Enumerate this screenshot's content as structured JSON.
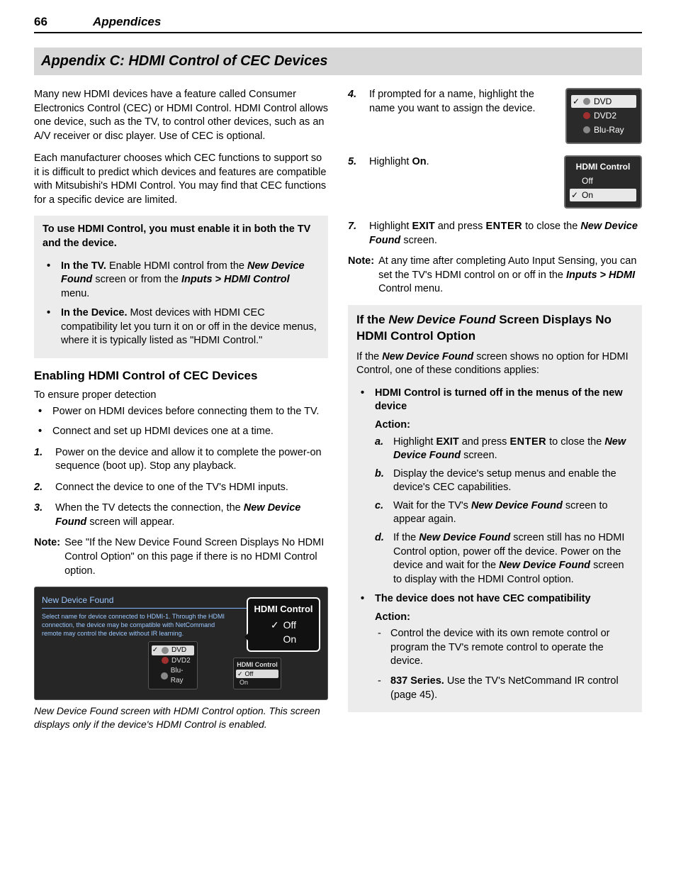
{
  "header": {
    "page": "66",
    "section": "Appendices"
  },
  "appendix_title": "Appendix C:  HDMI Control of CEC Devices",
  "left": {
    "intro1": "Many new HDMI devices have a feature called Consumer Electronics Control (CEC) or HDMI Control. HDMI Control allows one device, such as the TV, to control other devices, such as an A/V receiver or disc player.  Use of CEC is optional.",
    "intro2": "Each manufacturer chooses which CEC functions to support so it is difficult to predict which devices and features are compatible with Mitsubishi's HDMI Control. You may find that CEC functions for a specific device are limited.",
    "box": {
      "lead": "To use HDMI Control, you must enable it in both the TV and the device.",
      "tv_label": "In the TV.",
      "tv_text_a": "  Enable HDMI control from the ",
      "tv_text_b": "New Device Found",
      "tv_text_c": " screen or from the ",
      "tv_text_d": "Inputs > HDMI Control",
      "tv_text_e": " menu.",
      "dev_label": "In the Device.",
      "dev_text": "  Most devices with HDMI CEC compatibility let you turn it on or off in the device menus, where it is typically listed as \"HDMI Control.\""
    },
    "enable_head": "Enabling HDMI Control of CEC Devices",
    "ensure": "To ensure proper detection",
    "ensure_b1": "Power on HDMI devices before connecting them to the TV.",
    "ensure_b2": "Connect and set up HDMI devices one at a time.",
    "s1": {
      "n": "1.",
      "t": "Power on the device and allow it to complete the power-on sequence (boot up).  Stop any playback."
    },
    "s2": {
      "n": "2.",
      "t": "Connect the device to one of the TV's HDMI inputs."
    },
    "s3": {
      "n": "3.",
      "a": "When the TV detects the connection, the ",
      "b": "New Device Found",
      "c": " screen will appear."
    },
    "note": {
      "label": "Note:",
      "t": "See \"If the New Device Found Screen Displays No HDMI Control Option\" on this page if there is no HDMI Control option."
    },
    "shot": {
      "title": "New Device Found",
      "desc": "Select name for device connected to HDMI-1.\nThrough the HDMI connection, the device may be compatible with NetCommand remote may control the device without IR learning.",
      "dev": [
        "DVD",
        "DVD2",
        "Blu-Ray"
      ],
      "hdmi_label": "HDMI Control",
      "off": "Off",
      "on": "On"
    },
    "caption": "New Device Found screen with HDMI Control option. This screen displays only if the device's HDMI Control is enabled."
  },
  "right": {
    "s4": {
      "n": "4.",
      "t": "If prompted for a name, highlight the name you want to assign the device."
    },
    "box4": {
      "items": [
        "DVD",
        "DVD2",
        "Blu-Ray"
      ]
    },
    "s5": {
      "n": "5.",
      "a": "Highlight ",
      "b": "On",
      "c": "."
    },
    "box5": {
      "title": "HDMI Control",
      "off": "Off",
      "on": "On"
    },
    "s7": {
      "n": "7.",
      "a": "Highlight ",
      "b": "EXIT",
      "c": " and press ",
      "d": "ENTER",
      "e": " to close the ",
      "f": "New Device Found",
      "g": " screen."
    },
    "note": {
      "label": "Note:",
      "a": "At any time after completing Auto Input Sensing, you can set the TV's HDMI control on or off in the ",
      "b": "Inputs > HDMI",
      "c": " Control menu."
    },
    "nohdmi": {
      "head_a": "If the ",
      "head_b": "New Device Found",
      "head_c": " Screen Displays No HDMI Control Option",
      "intro_a": "If the ",
      "intro_b": "New Device Found",
      "intro_c": " screen shows no option for HDMI Control, one of these conditions applies:",
      "b1": "HDMI Control is turned off in the menus of the new device",
      "action": "Action:",
      "la": {
        "lt": "a.",
        "a": "Highlight ",
        "b": "EXIT",
        "c": " and press ",
        "d": "ENTER",
        "e": " to close the ",
        "f": "New Device Found",
        "g": " screen."
      },
      "lb": {
        "lt": "b.",
        "t": "Display the device's setup menus and enable the device's CEC capabilities."
      },
      "lc": {
        "lt": "c.",
        "a": "Wait for the TV's ",
        "b": "New Device Found",
        "c": " screen to appear again."
      },
      "ld": {
        "lt": "d.",
        "a": "If the ",
        "b": "New Device Found",
        "c": " screen still has no HDMI Control option, power off the device. Power on the device and wait for the ",
        "d": "New Device Found",
        "e": " screen to display with the HDMI Control option."
      },
      "b2": "The device does not have CEC compatibility",
      "d1": "Control the device with its own remote control or program the TV's remote control to operate the device.",
      "d2a": "837 Series.",
      "d2b": "  Use the TV's NetCommand IR control (page 45)."
    }
  }
}
